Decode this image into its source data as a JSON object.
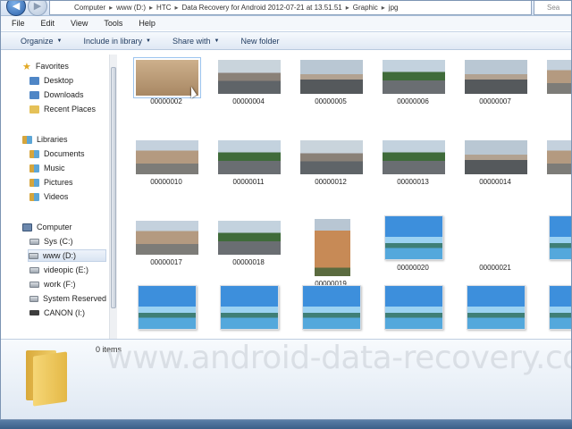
{
  "address_bar": {
    "breadcrumbs": [
      "Computer",
      "www (D:)",
      "HTC",
      "Data Recovery for Android 2012-07-21 at 13.51.51",
      "Graphic",
      "jpg"
    ],
    "search_placeholder": "Sea"
  },
  "menu": {
    "items": [
      "File",
      "Edit",
      "View",
      "Tools",
      "Help"
    ]
  },
  "toolbar": {
    "organize": "Organize",
    "include": "Include in library",
    "share": "Share with",
    "new_folder": "New folder"
  },
  "sidebar": {
    "favorites_header": "Favorites",
    "favorites": [
      "Desktop",
      "Downloads",
      "Recent Places"
    ],
    "libraries_header": "Libraries",
    "libraries": [
      "Documents",
      "Music",
      "Pictures",
      "Videos"
    ],
    "computer_header": "Computer",
    "drives": [
      "Sys (C:)",
      "www (D:)",
      "videopic (E:)",
      "work (F:)",
      "System Reserved",
      "CANON (I:)"
    ]
  },
  "files": [
    {
      "name": "00000002",
      "kind": "sand"
    },
    {
      "name": "00000004",
      "kind": "street"
    },
    {
      "name": "00000005",
      "kind": "street2"
    },
    {
      "name": "00000006",
      "kind": "tree"
    },
    {
      "name": "00000007",
      "kind": "street2"
    },
    {
      "name": "",
      "kind": "bldg"
    },
    {
      "name": "00000010",
      "kind": "bldg"
    },
    {
      "name": "00000011",
      "kind": "tree"
    },
    {
      "name": "00000012",
      "kind": "street"
    },
    {
      "name": "00000013",
      "kind": "tree"
    },
    {
      "name": "00000014",
      "kind": "street2"
    },
    {
      "name": "",
      "kind": "bldg"
    },
    {
      "name": "00000017",
      "kind": "bldg"
    },
    {
      "name": "00000018",
      "kind": "tree"
    },
    {
      "name": "00000019",
      "kind": "tall"
    },
    {
      "name": "00000020",
      "kind": "placeholder"
    },
    {
      "name": "00000021",
      "kind": "none"
    },
    {
      "name": "",
      "kind": "placeholder"
    },
    {
      "name": "",
      "kind": "placeholder"
    },
    {
      "name": "",
      "kind": "placeholder"
    },
    {
      "name": "",
      "kind": "placeholder"
    },
    {
      "name": "",
      "kind": "placeholder"
    },
    {
      "name": "",
      "kind": "placeholder"
    },
    {
      "name": "",
      "kind": "placeholder"
    }
  ],
  "details": {
    "items_count": "0 items"
  },
  "watermark": "www.android-data-recovery.com"
}
